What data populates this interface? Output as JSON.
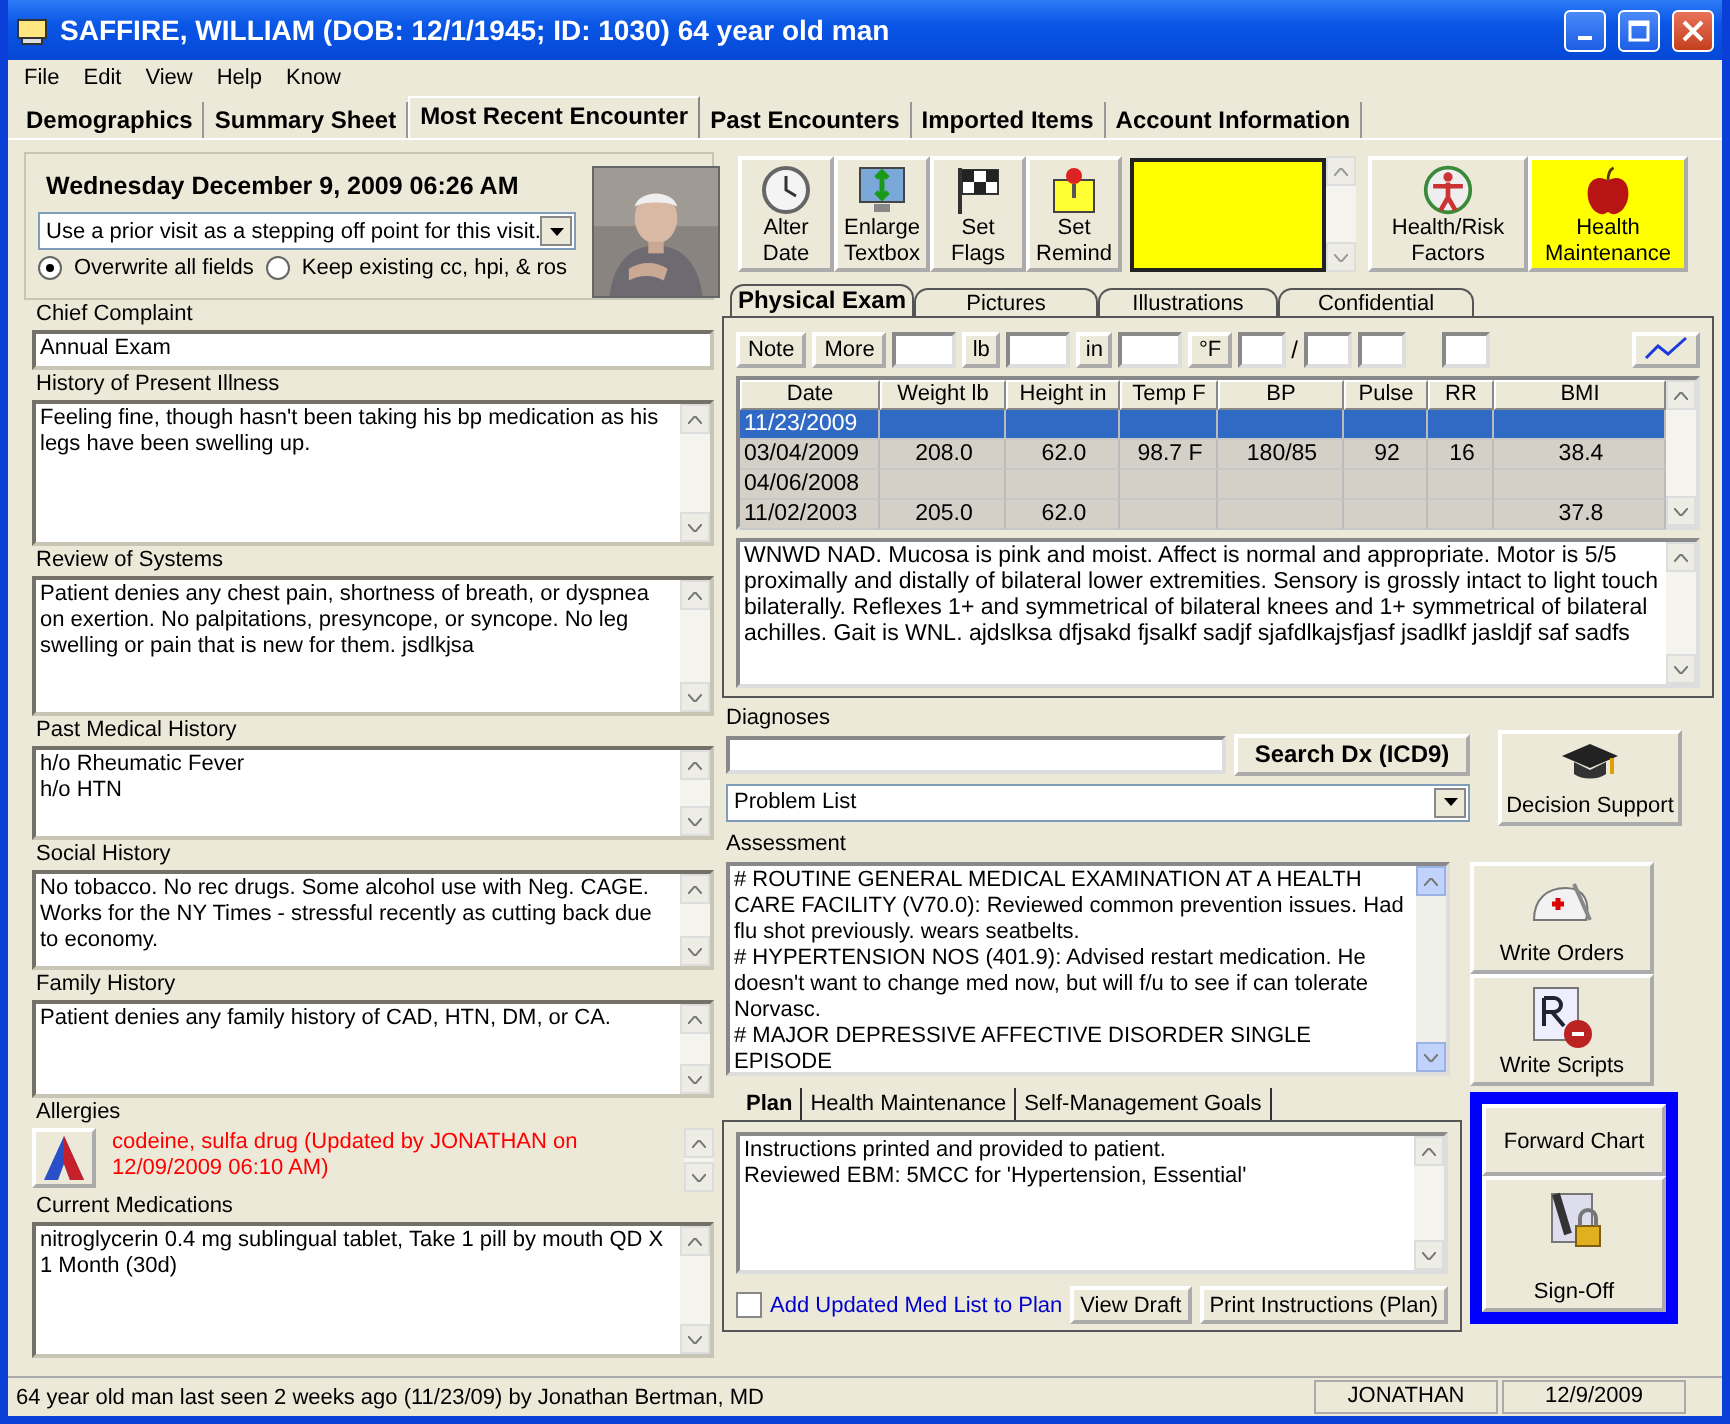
{
  "window": {
    "title": "SAFFIRE, WILLIAM (DOB: 12/1/1945; ID: 1030) 64 year old man"
  },
  "menu": [
    "File",
    "Edit",
    "View",
    "Help",
    "Know"
  ],
  "tabs": [
    {
      "label": "Demographics",
      "selected": false
    },
    {
      "label": "Summary Sheet",
      "selected": false
    },
    {
      "label": "Most Recent Encounter",
      "selected": true
    },
    {
      "label": "Past Encounters",
      "selected": false
    },
    {
      "label": "Imported Items",
      "selected": false
    },
    {
      "label": "Account Information",
      "selected": false
    }
  ],
  "encounter": {
    "datetime": "Wednesday December 9, 2009  06:26 AM",
    "prior_visit": "Use a prior visit as a stepping off point for this visit.",
    "options": [
      {
        "label": "Overwrite all fields",
        "selected": true
      },
      {
        "label": "Keep existing cc, hpi, & ros",
        "selected": false
      }
    ]
  },
  "sections": [
    {
      "label": "Chief Complaint",
      "kind": "line",
      "text": "Annual Exam"
    },
    {
      "label": "History of Present Illness",
      "kind": "memo",
      "text": "Feeling fine, though hasn't been taking his bp medication as his legs have been swelling up."
    },
    {
      "label": "Review of Systems",
      "kind": "memo",
      "text": "Patient denies any chest pain, shortness of breath, or dyspnea on exertion. No palpitations, presyncope, or syncope. No leg swelling or pain that is new for them. jsdlkjsa"
    },
    {
      "label": "Past Medical History",
      "kind": "memo",
      "text": "h/o Rheumatic Fever\nh/o HTN"
    },
    {
      "label": "Social History",
      "kind": "memo",
      "text": "No tobacco. No rec drugs. Some alcohol use with Neg. CAGE. Works for the NY Times - stressful recently as cutting back due to economy."
    },
    {
      "label": "Family History",
      "kind": "memo",
      "text": "Patient denies any family history of CAD, HTN, DM, or CA."
    },
    {
      "label": "Allergies",
      "kind": "allergy",
      "text": "codeine, sulfa drug (Updated by JONATHAN on 12/09/2009 06:10 AM)"
    },
    {
      "label": "Current Medications",
      "kind": "memo",
      "text": "nitroglycerin 0.4 mg sublingual tablet, Take 1 pill by mouth QD X 1 Month (30d)"
    }
  ],
  "toolbar": [
    {
      "label": "Alter Date",
      "kind": "clock"
    },
    {
      "label": "Enlarge Textbox",
      "kind": "monitor"
    },
    {
      "label": "Set Flags",
      "kind": "flag"
    },
    {
      "label": "Set Remind",
      "kind": "pin"
    }
  ],
  "side_buttons": [
    {
      "label": "Health/Risk Factors",
      "kind": "figure",
      "highlighted": false
    },
    {
      "label": "Health Maintenance",
      "kind": "apple",
      "highlighted": true
    }
  ],
  "exam_tabs": [
    {
      "label": "Physical Exam",
      "selected": true
    },
    {
      "label": "Pictures",
      "selected": false
    },
    {
      "label": "Illustrations",
      "selected": false
    },
    {
      "label": "Confidential",
      "selected": false
    }
  ],
  "vitals_entry": {
    "buttons": [
      "Note",
      "More"
    ],
    "units": [
      "lb",
      "in",
      "°F"
    ],
    "separator": "/"
  },
  "vitals_table": {
    "columns": [
      "Date",
      "Weight lb",
      "Height in",
      "Temp F",
      "BP",
      "Pulse",
      "RR",
      "BMI"
    ],
    "rows": [
      {
        "selected": true,
        "cells": [
          "11/23/2009",
          "",
          "",
          "",
          "",
          "",
          "",
          ""
        ]
      },
      {
        "selected": false,
        "cells": [
          "03/04/2009",
          "208.0",
          "62.0",
          "98.7 F",
          "180/85",
          "92",
          "16",
          "38.4"
        ]
      },
      {
        "selected": false,
        "cells": [
          "04/06/2008",
          "",
          "",
          "",
          "",
          "",
          "",
          ""
        ]
      },
      {
        "selected": false,
        "cells": [
          "11/02/2003",
          "205.0",
          "62.0",
          "",
          "",
          "",
          "",
          "37.8"
        ]
      }
    ]
  },
  "exam_note": "WNWD NAD. Mucosa is pink and moist. Affect is normal and appropriate. Motor is 5/5 proximally and distally of bilateral lower extremities. Sensory is grossly intact to light touch bilaterally. Reflexes 1+ and symmetrical of bilateral knees and 1+ symmetrical of bilateral achilles. Gait is WNL. ajdslksa dfjsakd fjsalkf sadjf sjafdlkajsfjasf jsadlkf jasldjf saf sadfs",
  "diagnoses": {
    "label": "Diagnoses",
    "search_button": "Search Dx (ICD9)",
    "problem_list": "Problem List",
    "decision_support": "Decision Support"
  },
  "assessment": {
    "label": "Assessment",
    "entries": [
      "# ROUTINE GENERAL MEDICAL EXAMINATION AT A HEALTH CARE FACILITY (V70.0): Reviewed common prevention issues. Had flu shot previously. wears seatbelts.",
      "# HYPERTENSION NOS (401.9): Advised restart medication. He doesn't want to change med now, but will f/u to see if can tolerate Norvasc.",
      "# MAJOR DEPRESSIVE AFFECTIVE DISORDER SINGLE EPISODE"
    ]
  },
  "order_buttons": [
    {
      "label": "Write Orders",
      "kind": "kit"
    },
    {
      "label": "Write Scripts",
      "kind": "rx"
    }
  ],
  "plan_tabs": [
    {
      "label": "Plan",
      "selected": true
    },
    {
      "label": "Health Maintenance",
      "selected": false
    },
    {
      "label": "Self-Management Goals",
      "selected": false
    }
  ],
  "plan_text": [
    "Instructions printed and provided to patient.",
    "Reviewed EBM: 5MCC for 'Hypertension, Essential'"
  ],
  "add_med_list": {
    "label": "Add Updated Med List to Plan",
    "checked": false
  },
  "plan_buttons": [
    "View Draft",
    "Print Instructions (Plan)"
  ],
  "signoff": {
    "forward": "Forward Chart",
    "sign": "Sign-Off"
  },
  "status_bar": {
    "message": "64 year old man last seen 2 weeks ago (11/23/09) by Jonathan Bertman, MD",
    "user": "JONATHAN",
    "date": "12/9/2009"
  }
}
